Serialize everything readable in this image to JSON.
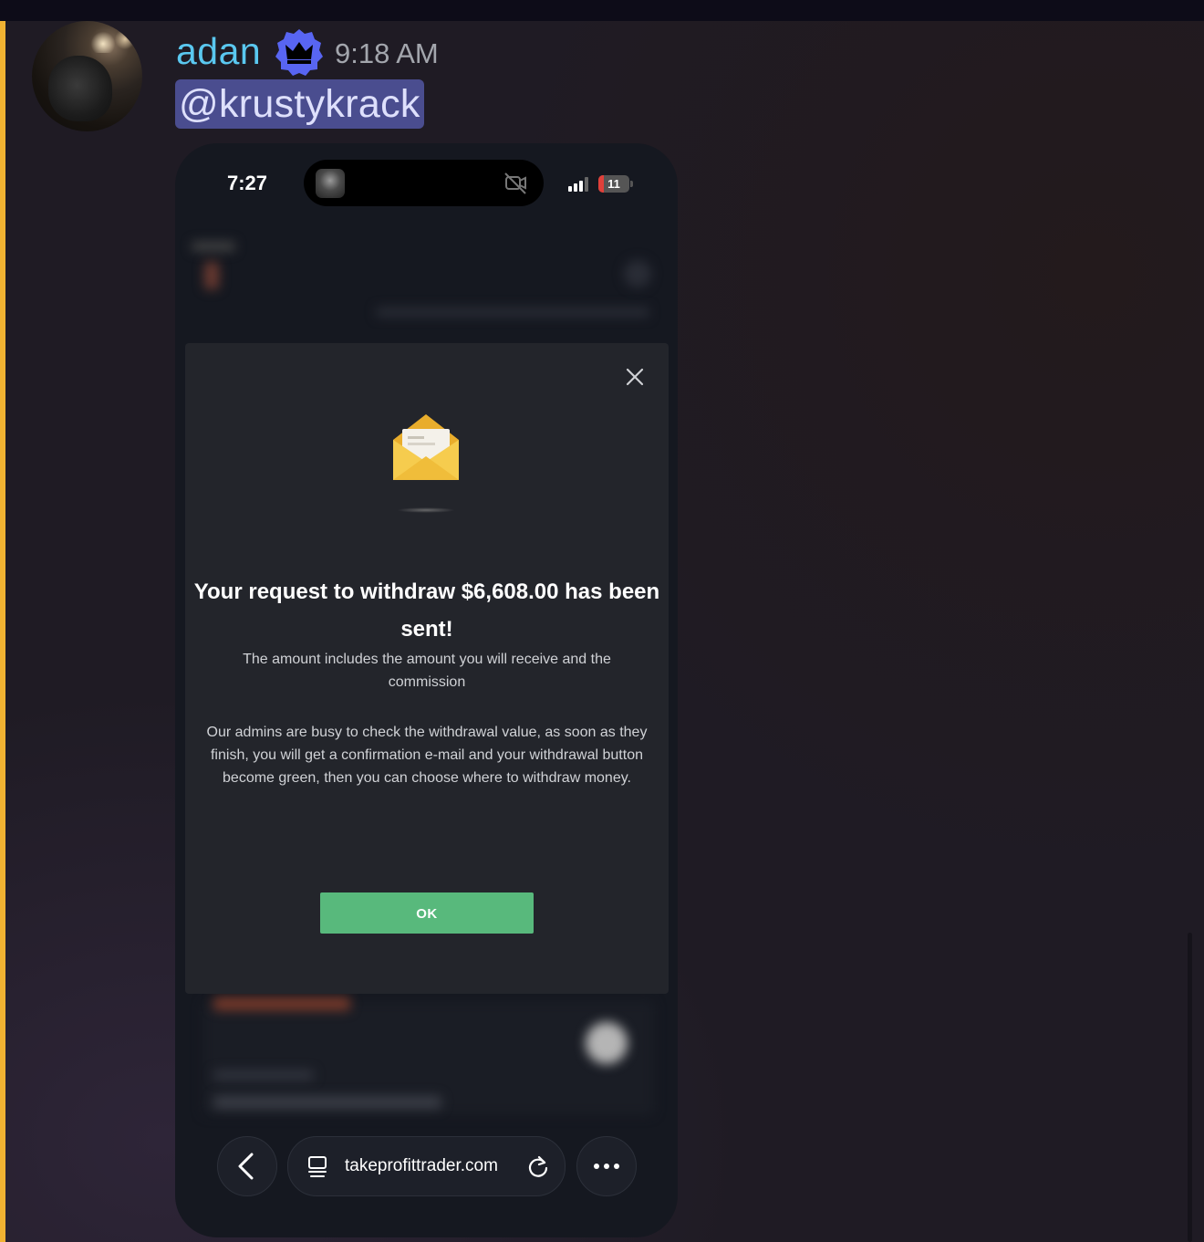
{
  "message": {
    "author": "adan",
    "timestamp": "9:18 AM",
    "mention": "@krustykrack"
  },
  "phone": {
    "status_time": "7:27",
    "battery": "11"
  },
  "dialog": {
    "title": "Your request to withdraw $6,608.00 has been sent!",
    "subtitle": "The amount includes the amount you will receive and the commission",
    "body": "Our admins are busy to check the withdrawal value, as soon as they finish, you will get a confirmation e-mail and your withdrawal button become green, then you can choose where to withdraw money.",
    "ok_label": "OK"
  },
  "browser": {
    "url": "takeprofittrader.com"
  },
  "colors": {
    "username": "#5ac8f0",
    "mention_bg": "#4a4d8f",
    "ok_button": "#58b97c",
    "mention_bar": "#f0b232"
  }
}
